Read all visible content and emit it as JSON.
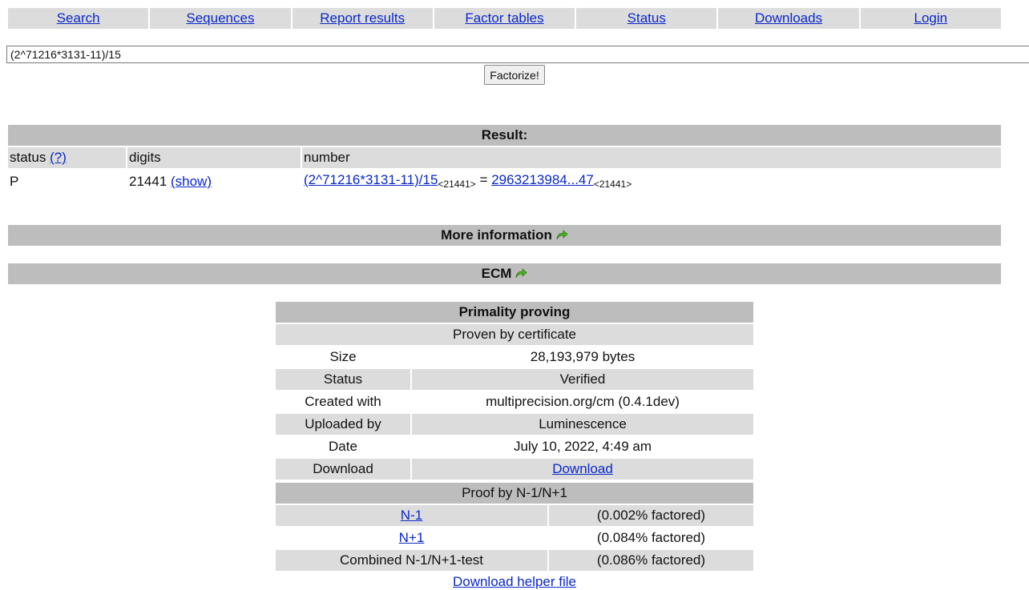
{
  "nav": [
    "Search",
    "Sequences",
    "Report results",
    "Factor tables",
    "Status",
    "Downloads",
    "Login"
  ],
  "query": {
    "value": "(2^71216*3131-11)/15",
    "button": "Factorize!"
  },
  "result": {
    "heading": "Result:",
    "col_status": "status",
    "col_status_help": "(?)",
    "col_digits": "digits",
    "col_number": "number",
    "row": {
      "status": "P",
      "digits": "21441",
      "show": "(show)",
      "expr": "(2^71216*3131-11)/15",
      "expr_sub": "<21441>",
      "equals": "=",
      "value": "2963213984...47",
      "value_sub": "<21441>"
    }
  },
  "more_info": "More information",
  "ecm": "ECM",
  "primality": {
    "heading": "Primality proving",
    "proven_by": "Proven by certificate",
    "rows": [
      {
        "label": "Size",
        "value": "28,193,979 bytes"
      },
      {
        "label": "Status",
        "value": "Verified"
      },
      {
        "label": "Created with",
        "value": "multiprecision.org/cm (0.4.1dev)"
      },
      {
        "label": "Uploaded by",
        "value": "Luminescence"
      },
      {
        "label": "Date",
        "value": "July 10, 2022, 4:49 am"
      },
      {
        "label": "Download",
        "value": "Download"
      }
    ],
    "proof_heading": "Proof by N-1/N+1",
    "proof_rows": [
      {
        "label": "N-1",
        "value": "(0.002% factored)"
      },
      {
        "label": "N+1",
        "value": "(0.084% factored)"
      },
      {
        "label": "Combined N-1/N+1-test",
        "value": "(0.086% factored)"
      }
    ],
    "helper": "Download helper file"
  },
  "colors": {
    "link": "#0a28c8",
    "header_dark": "#bdbdbd",
    "header_light": "#dcdcdc",
    "arrow": "#4caf28"
  }
}
